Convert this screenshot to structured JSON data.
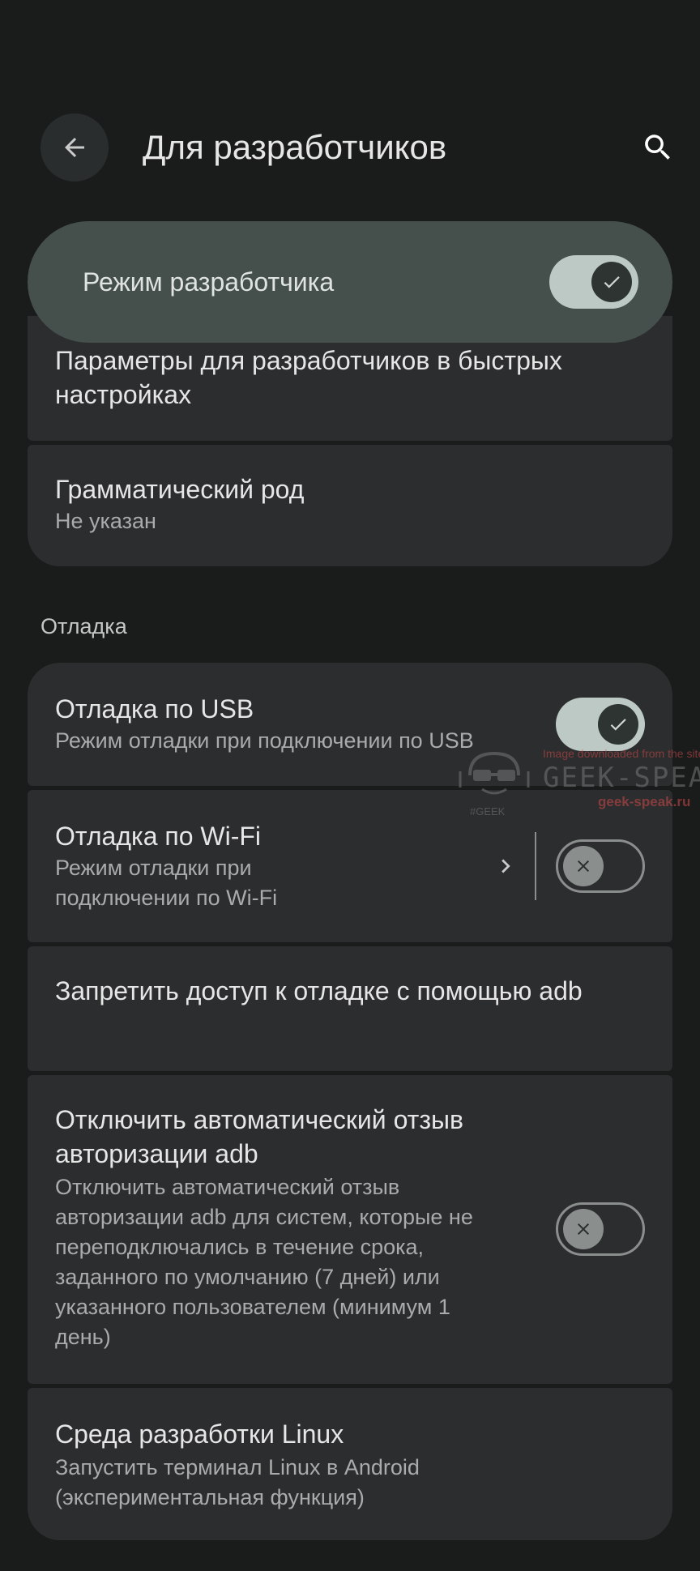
{
  "header": {
    "title": "Для разработчиков"
  },
  "developer_mode": {
    "label": "Режим разработчика",
    "enabled": true
  },
  "items_top": [
    {
      "title": "Параметры для разработчиков в быстрых настройках"
    },
    {
      "title": "Грамматический род",
      "subtitle": "Не указан"
    }
  ],
  "section": {
    "debug": "Отладка"
  },
  "usb_debug": {
    "title": "Отладка по USB",
    "subtitle": "Режим отладки при подключении по USB",
    "enabled": true
  },
  "wifi_debug": {
    "title": "Отладка по Wi-Fi",
    "subtitle": "Режим отладки при подключении по Wi-Fi",
    "enabled": false
  },
  "revoke_adb": {
    "title": "Запретить доступ к отладке с помощью adb"
  },
  "auto_revoke": {
    "title": "Отключить автоматический отзыв авторизации adb",
    "subtitle": "Отключить автоматический отзыв авторизации adb для систем, которые не переподключались в течение срока, заданного по умолчанию (7 дней) или указанного пользователем (минимум 1 день)",
    "enabled": false
  },
  "linux": {
    "title": "Среда разработки Linux",
    "subtitle": "Запустить терминал Linux в Android (экспериментальная функция)"
  },
  "watermark": {
    "top": "Image downloaded from the site",
    "main": "GEEK-SPEAK",
    "url": "geek-speak.ru",
    "tag": "#GEEK"
  },
  "colors": {
    "background": "#1a1c1c",
    "card": "#2b2d2e",
    "switch_on": "#bdc9c4",
    "highlight": "#45504d"
  }
}
